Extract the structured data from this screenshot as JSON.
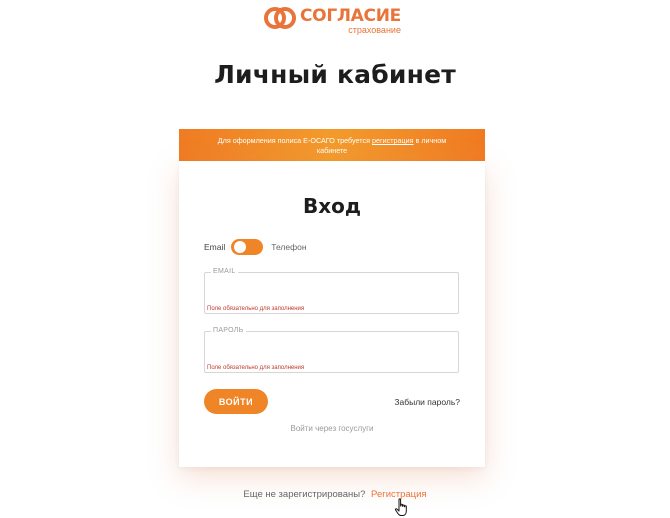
{
  "brand": {
    "name": "СОГЛАСИЕ",
    "subtitle": "страхование",
    "accent_color": "#ef8526"
  },
  "page": {
    "title": "Личный кабинет"
  },
  "banner": {
    "text_before": "Для оформления полиса Е-ОСАГО требуется",
    "link": "регистрация",
    "text_after": "в личном кабинете"
  },
  "login_card": {
    "title": "Вход",
    "toggle": {
      "left_label": "Email",
      "right_label": "Телефон"
    },
    "email_field": {
      "label": "EMAIL",
      "value": "",
      "error": "Поле обязательно для заполнения"
    },
    "password_field": {
      "label": "ПАРОЛЬ",
      "value": "",
      "error": "Поле обязательно для заполнения"
    },
    "login_button": "ВОЙТИ",
    "forgot_password": "Забыли пароль?",
    "gosuslugi": "Войти через госуслуги"
  },
  "register": {
    "prompt": "Еще не зарегистрированы?",
    "link": "Регистрация"
  },
  "icons": {
    "logo": "soglasie-rings-icon",
    "cursor": "hand-pointer-icon"
  }
}
